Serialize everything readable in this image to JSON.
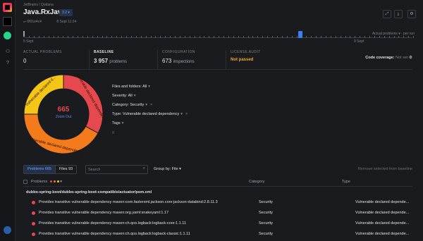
{
  "header": {
    "breadcrumb": "JetBrains / Qodana",
    "title": "Java.RxJava",
    "version_badge": "3.2",
    "commit": "0f01e4c4",
    "date": "8 Sept 11:24"
  },
  "timeline": {
    "start_label": "5 Sept",
    "end_label": "9 Sept",
    "legend": "Actual problems",
    "legend2": "per run"
  },
  "stats": {
    "actual_problems_label": "ACTUAL PROBLEMS",
    "actual_problems_value": "0",
    "baseline_label": "BASELINE",
    "baseline_value": "3 957",
    "baseline_unit": "problems",
    "configuration_label": "CONFIGURATION",
    "configuration_value": "673",
    "configuration_unit": "inspections",
    "license_label": "LICENSE AUDIT",
    "license_value": "Not passed",
    "coverage_label": "Code coverage:",
    "coverage_value": "Not set"
  },
  "donut": {
    "count": "665",
    "zoom_label": "Zoom Out",
    "segments": [
      {
        "label": "vulnerable declared dependency",
        "value": 0.33,
        "color": "#e5484d"
      },
      {
        "label": "Vulnerable declared dependency",
        "value": 0.42,
        "color": "#f47b1b"
      },
      {
        "label": "Vulnerable declared d...",
        "value": 0.25,
        "color": "#f5c518"
      }
    ]
  },
  "filters": {
    "files": "Files and folders: All",
    "severity": "Severity: All",
    "category": "Category: Security",
    "type": "Type: Vulnerable declared dependency",
    "tags": "Tags"
  },
  "toolbar": {
    "tab_problems": "Problems 665",
    "tab_files": "Files 93",
    "search_placeholder": "Search",
    "group_by": "Group by: File",
    "remove": "Remove selected from baseline"
  },
  "table": {
    "col_problems": "Problems",
    "col_category": "Category",
    "col_type": "Type",
    "group_path": "dubbo-spring-boot/dubbo-spring-boot-compatible/actuator/pom.xml",
    "rows": [
      {
        "text": "Provides transitive vulnerable dependency maven:com.fasterxml.jackson.core:jackson-databind:2.8.11.3",
        "category": "Security",
        "type": "Vulnerable declared depende..."
      },
      {
        "text": "Provides transitive vulnerable dependency maven:org.yaml:snakeyaml:1.17",
        "category": "Security",
        "type": "Vulnerable declared depende..."
      },
      {
        "text": "Provides transitive vulnerable dependency maven:ch.qos.logback:logback-core:1.1.11",
        "category": "Security",
        "type": "Vulnerable declared depende..."
      },
      {
        "text": "Provides transitive vulnerable dependency maven:ch.qos.logback:logback-classic:1.1.11",
        "category": "Security",
        "type": "Vulnerable declared depende..."
      }
    ]
  }
}
